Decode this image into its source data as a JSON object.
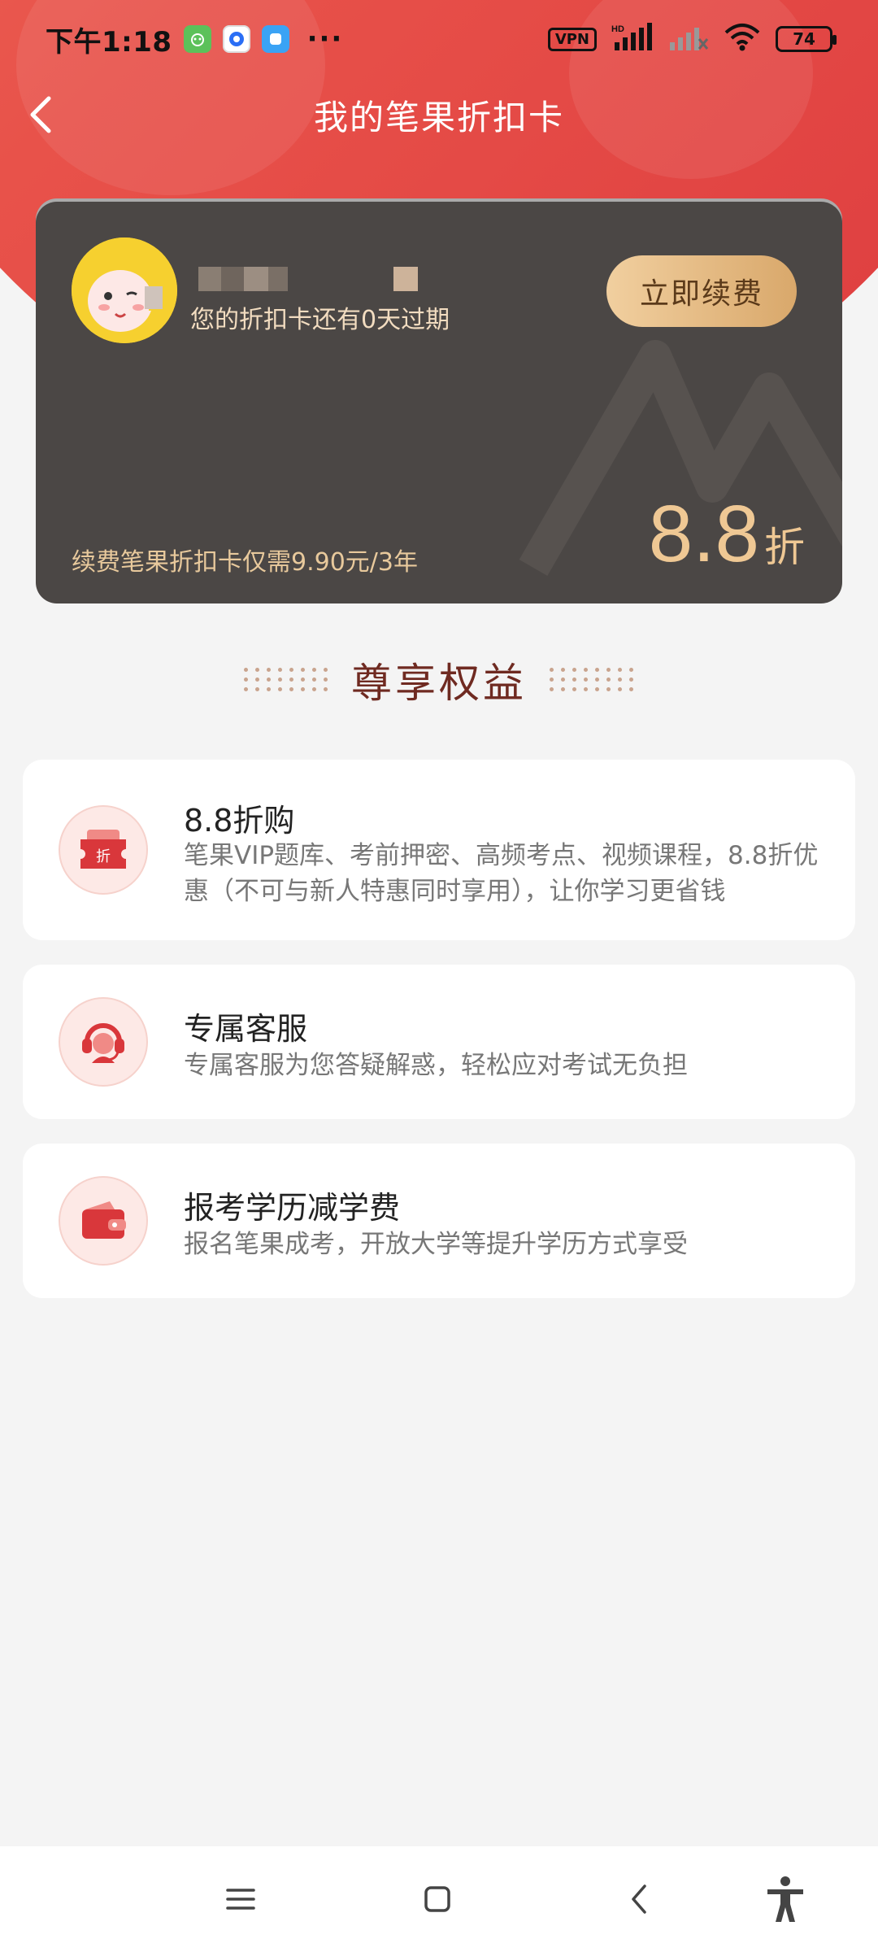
{
  "status_bar": {
    "time": "下午1:18",
    "more": "···",
    "vpn": "VPN",
    "signal_label": "HD",
    "battery": "74"
  },
  "header": {
    "title": "我的笔果折扣卡"
  },
  "card": {
    "expiry_text": "您的折扣卡还有0天过期",
    "renew_button": "立即续费",
    "offer_text": "续费笔果折扣卡仅需9.90元/3年",
    "discount_value": "8.8",
    "discount_unit": "折"
  },
  "section": {
    "title": "尊享权益"
  },
  "benefits": [
    {
      "title": "8.8折购",
      "icon_text": "折",
      "icon": "discount-ticket-icon",
      "desc": "笔果VIP题库、考前押密、高频考点、视频课程，8.8折优惠（不可与新人特惠同时享用），让你学习更省钱"
    },
    {
      "title": "专属客服",
      "icon": "customer-service-icon",
      "desc": "专属客服为您答疑解惑，轻松应对考试无负担"
    },
    {
      "title": "报考学历减学费",
      "icon": "wallet-icon",
      "desc": "报名笔果成考，开放大学等提升学历方式享受"
    }
  ],
  "colors": {
    "header_red": "#e8524a",
    "card_bg": "#4b4745",
    "gold": "#efc894",
    "section_title": "#6f2a21",
    "icon_red": "#d9373b"
  }
}
